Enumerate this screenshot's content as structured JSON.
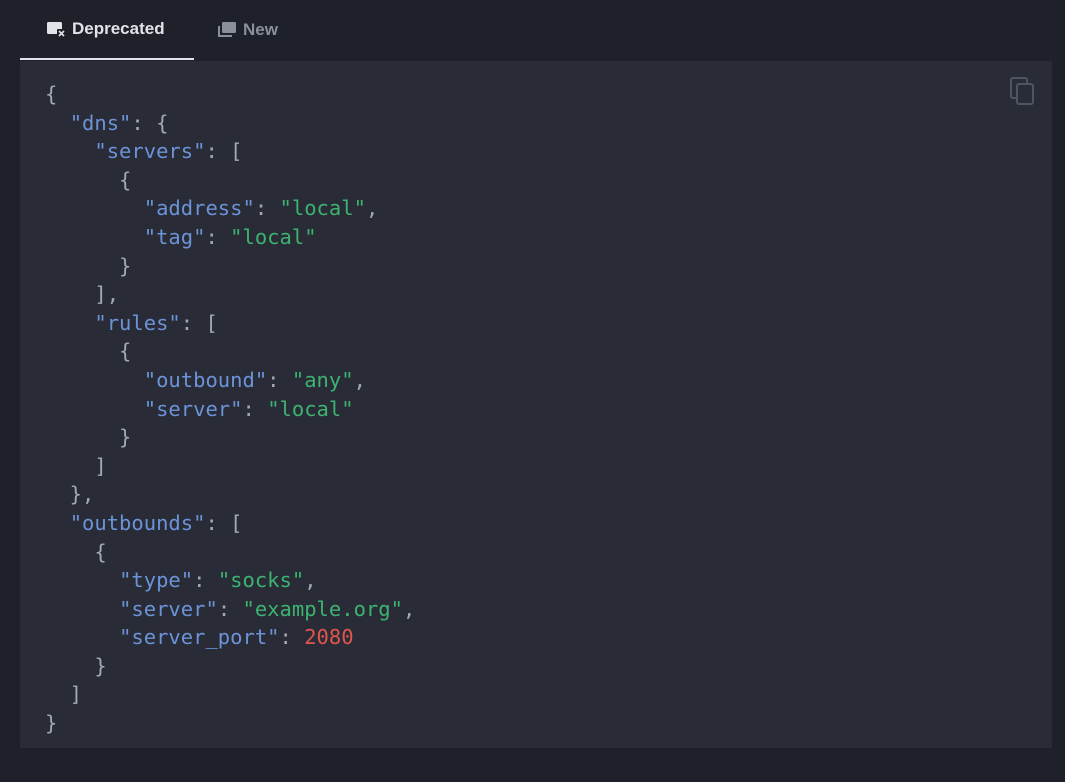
{
  "tabs": [
    {
      "label": "Deprecated",
      "icon": "deprecated-window-icon",
      "active": true
    },
    {
      "label": "New",
      "icon": "windows-icon",
      "active": false
    }
  ],
  "copy_button": {
    "icon": "copy-icon"
  },
  "code": {
    "language": "json",
    "lines": [
      [
        {
          "t": "p",
          "v": "{"
        }
      ],
      [
        {
          "t": "p",
          "v": "  "
        },
        {
          "t": "k",
          "v": "\"dns\""
        },
        {
          "t": "p",
          "v": ": {"
        }
      ],
      [
        {
          "t": "p",
          "v": "    "
        },
        {
          "t": "k",
          "v": "\"servers\""
        },
        {
          "t": "p",
          "v": ": ["
        }
      ],
      [
        {
          "t": "p",
          "v": "      {"
        }
      ],
      [
        {
          "t": "p",
          "v": "        "
        },
        {
          "t": "k",
          "v": "\"address\""
        },
        {
          "t": "p",
          "v": ": "
        },
        {
          "t": "s",
          "v": "\"local\""
        },
        {
          "t": "p",
          "v": ","
        }
      ],
      [
        {
          "t": "p",
          "v": "        "
        },
        {
          "t": "k",
          "v": "\"tag\""
        },
        {
          "t": "p",
          "v": ": "
        },
        {
          "t": "s",
          "v": "\"local\""
        }
      ],
      [
        {
          "t": "p",
          "v": "      }"
        }
      ],
      [
        {
          "t": "p",
          "v": "    ],"
        }
      ],
      [
        {
          "t": "p",
          "v": "    "
        },
        {
          "t": "k",
          "v": "\"rules\""
        },
        {
          "t": "p",
          "v": ": ["
        }
      ],
      [
        {
          "t": "p",
          "v": "      {"
        }
      ],
      [
        {
          "t": "p",
          "v": "        "
        },
        {
          "t": "k",
          "v": "\"outbound\""
        },
        {
          "t": "p",
          "v": ": "
        },
        {
          "t": "s",
          "v": "\"any\""
        },
        {
          "t": "p",
          "v": ","
        }
      ],
      [
        {
          "t": "p",
          "v": "        "
        },
        {
          "t": "k",
          "v": "\"server\""
        },
        {
          "t": "p",
          "v": ": "
        },
        {
          "t": "s",
          "v": "\"local\""
        }
      ],
      [
        {
          "t": "p",
          "v": "      }"
        }
      ],
      [
        {
          "t": "p",
          "v": "    ]"
        }
      ],
      [
        {
          "t": "p",
          "v": "  },"
        }
      ],
      [
        {
          "t": "p",
          "v": "  "
        },
        {
          "t": "k",
          "v": "\"outbounds\""
        },
        {
          "t": "p",
          "v": ": ["
        }
      ],
      [
        {
          "t": "p",
          "v": "    {"
        }
      ],
      [
        {
          "t": "p",
          "v": "      "
        },
        {
          "t": "k",
          "v": "\"type\""
        },
        {
          "t": "p",
          "v": ": "
        },
        {
          "t": "s",
          "v": "\"socks\""
        },
        {
          "t": "p",
          "v": ","
        }
      ],
      [
        {
          "t": "p",
          "v": "      "
        },
        {
          "t": "k",
          "v": "\"server\""
        },
        {
          "t": "p",
          "v": ": "
        },
        {
          "t": "s",
          "v": "\"example.org\""
        },
        {
          "t": "p",
          "v": ","
        }
      ],
      [
        {
          "t": "p",
          "v": "      "
        },
        {
          "t": "k",
          "v": "\"server_port\""
        },
        {
          "t": "p",
          "v": ": "
        },
        {
          "t": "n",
          "v": "2080"
        }
      ],
      [
        {
          "t": "p",
          "v": "    }"
        }
      ],
      [
        {
          "t": "p",
          "v": "  ]"
        }
      ],
      [
        {
          "t": "p",
          "v": "}"
        }
      ]
    ]
  },
  "colors": {
    "background": "#1e2129",
    "code_background": "#292c36",
    "key": "#6c93d8",
    "string": "#3cb371",
    "number": "#e0554e",
    "punctuation": "#a3a8b2"
  }
}
